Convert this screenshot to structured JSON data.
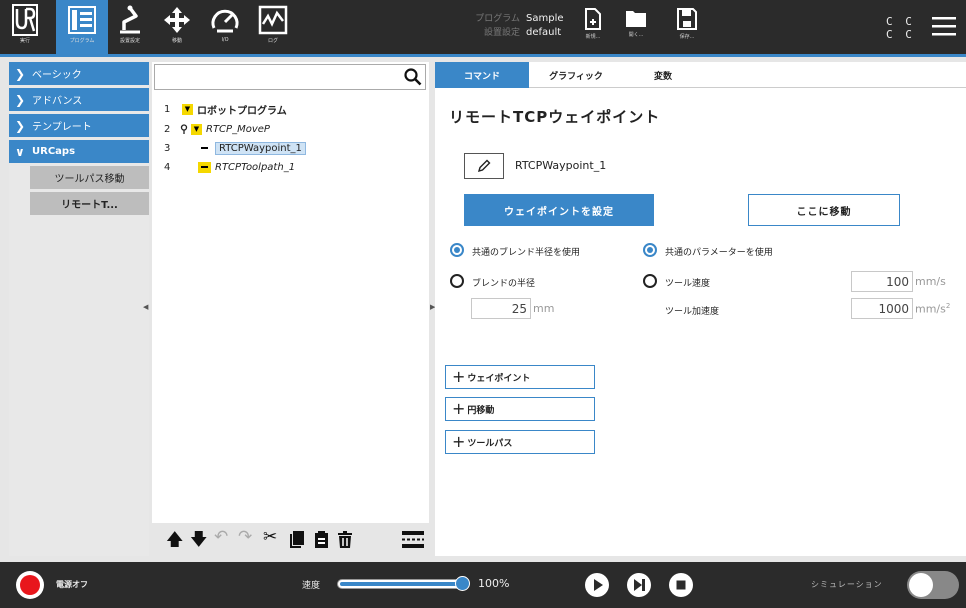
{
  "header": {
    "nav": [
      {
        "id": "run",
        "label": "実行",
        "icon": "ur-logo-icon"
      },
      {
        "id": "program",
        "label": "プログラム",
        "icon": "program-tree-icon"
      },
      {
        "id": "installation",
        "label": "設置設定",
        "icon": "robot-arm-icon"
      },
      {
        "id": "move",
        "label": "移動",
        "icon": "move-arrows-icon"
      },
      {
        "id": "io",
        "label": "I/O",
        "icon": "io-gauge-icon"
      },
      {
        "id": "log",
        "label": "ログ",
        "icon": "log-chart-icon"
      }
    ],
    "program_key": "プログラム",
    "program_value": "Sample",
    "installation_key": "設置設定",
    "installation_value": "default",
    "file_tools": [
      {
        "id": "new",
        "label": "新規...",
        "icon": "new-file-icon"
      },
      {
        "id": "open",
        "label": "開く...",
        "icon": "folder-icon"
      },
      {
        "id": "save",
        "label": "保存...",
        "icon": "save-icon"
      }
    ],
    "cc_line1": "C C",
    "cc_line2": "C C",
    "menu_icon": "hamburger-menu-icon"
  },
  "left_nav": {
    "items": [
      {
        "label": "ベーシック",
        "chevron": "❯"
      },
      {
        "label": "アドバンス",
        "chevron": "❯"
      },
      {
        "label": "テンプレート",
        "chevron": "❯"
      },
      {
        "label": "URCaps",
        "chevron": "∨"
      }
    ],
    "subitems": [
      {
        "label": "ツールパス移動"
      },
      {
        "label": "リモートT..."
      }
    ]
  },
  "tree": {
    "search_placeholder": "",
    "rows": [
      {
        "num": "1",
        "label": "ロボットプログラム"
      },
      {
        "num": "2",
        "label": "RTCP_MoveP"
      },
      {
        "num": "3",
        "label": "RTCPWaypoint_1"
      },
      {
        "num": "4",
        "label": "RTCPToolpath_1"
      }
    ]
  },
  "tabs": [
    {
      "label": "コマンド",
      "active": true
    },
    {
      "label": "グラフィック",
      "active": false
    },
    {
      "label": "変数",
      "active": false
    }
  ],
  "main": {
    "title": "リモートTCPウェイポイント",
    "waypoint_name": "RTCPWaypoint_1",
    "set_waypoint_button": "ウェイポイントを設定",
    "move_here_button": "ここに移動",
    "radio_shared_blend": "共通のブレンド半径を使用",
    "radio_blend_radius": "ブレンドの半径",
    "blend_value": "25",
    "blend_unit": "mm",
    "radio_shared_params": "共通のパラメーターを使用",
    "radio_tool_speed": "ツール速度",
    "tool_speed_value": "100",
    "tool_speed_unit": "mm/s",
    "tool_accel_label": "ツール加速度",
    "tool_accel_value": "1000",
    "tool_accel_unit": "mm/s",
    "tool_accel_unit_sup": "2",
    "add_waypoint": "ウェイポイント",
    "add_circle_move": "円移動",
    "add_toolpath": "ツールパス"
  },
  "footer": {
    "power_text": "電源オフ",
    "speed_label": "速度",
    "speed_value": "100%",
    "speed_fraction": 1.0,
    "sim_label": "シミュレーション"
  },
  "colors": {
    "accent": "#3a87c8",
    "header_bg": "#2b2b2b",
    "power_red": "#e8161c",
    "tree_marker": "#f5d800"
  }
}
